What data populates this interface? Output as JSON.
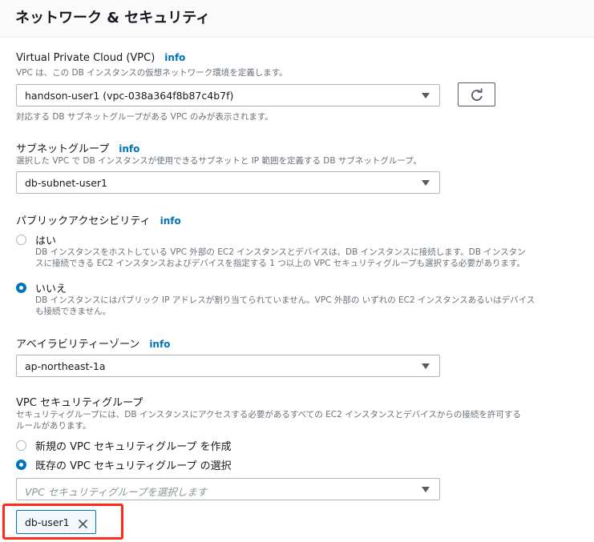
{
  "section": {
    "title": "ネットワーク & セキュリティ"
  },
  "vpc": {
    "label": "Virtual Private Cloud (VPC)",
    "info": "info",
    "description": "VPC は、この DB インスタンスの仮想ネットワーク環境を定義します。",
    "selected": "handson-user1 (vpc-038a364f8b87c4b7f)",
    "hint": "対応する DB サブネットグループがある VPC のみが表示されます。"
  },
  "subnet_group": {
    "label": "サブネットグループ",
    "info": "info",
    "description": "選択した VPC で DB インスタンスが使用できるサブネットと IP 範囲を定義する DB サブネットグループ。",
    "selected": "db-subnet-user1"
  },
  "public_access": {
    "label": "パブリックアクセシビリティ",
    "info": "info",
    "options": [
      {
        "label": "はい",
        "description_line1": "DB インスタンスをホストしている VPC 外部の EC2 インスタンスとデバイスは、DB インスタンスに接続します。DB インスタン",
        "description_line2": "スに接続できる EC2 インスタンスおよびデバイスを指定する 1 つ以上の VPC セキュリティグループも選択する必要があります。",
        "checked": false
      },
      {
        "label": "いいえ",
        "description_line1": "DB インスタンスにはパブリック IP アドレスが割り当てられていません。VPC 外部の いずれの EC2 インスタンスあるいはデバイス",
        "description_line2": "も接続できません。",
        "checked": true
      }
    ]
  },
  "availability_zone": {
    "label": "アベイラビリティーゾーン",
    "info": "info",
    "selected": "ap-northeast-1a"
  },
  "security_group": {
    "label": "VPC セキュリティグループ",
    "description_line1": "セキュリティグループには、DB インスタンスにアクセスする必要があるすべての EC2 インスタンスとデバイスからの接続を許可する",
    "description_line2": "ルールがあります。",
    "options": [
      {
        "label": "新規の VPC セキュリティグループ を作成",
        "checked": false
      },
      {
        "label": "既存の VPC セキュリティグループ の選択",
        "checked": true
      }
    ],
    "placeholder": "VPC セキュリティグループを選択します",
    "selected_tag": "db-user1"
  },
  "colors": {
    "accent": "#0073bb",
    "highlight": "#ff2a1a"
  }
}
